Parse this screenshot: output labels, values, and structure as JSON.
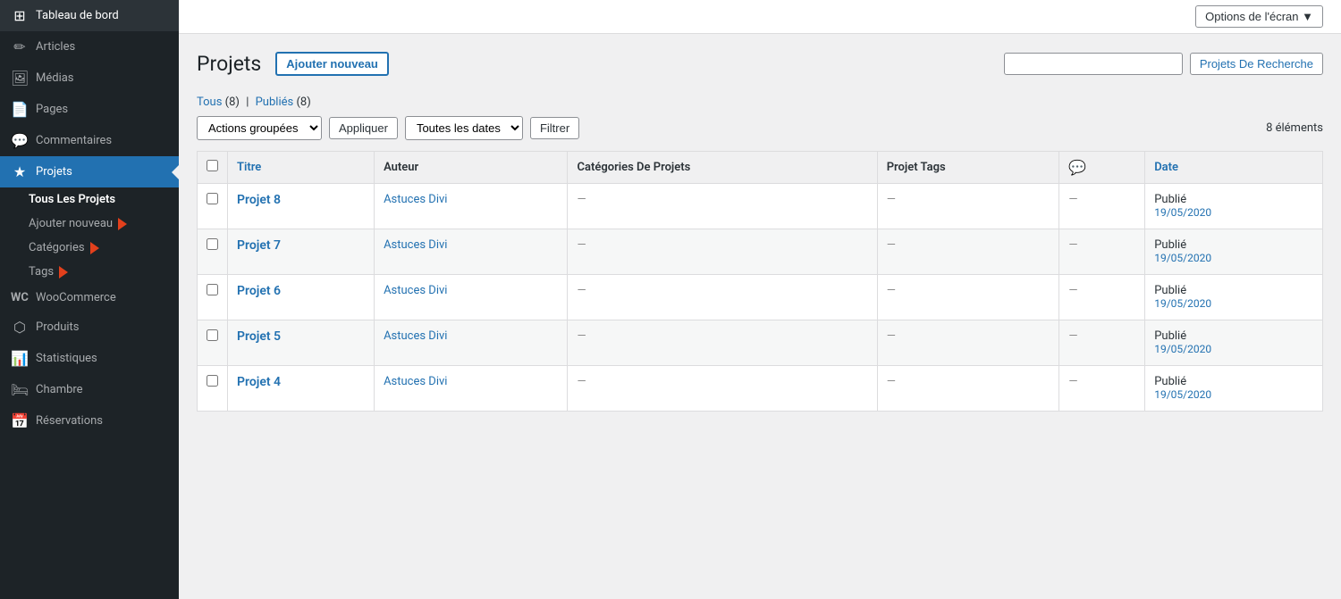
{
  "sidebar": {
    "items": [
      {
        "id": "tableau-de-bord",
        "label": "Tableau de bord",
        "icon": "⊞"
      },
      {
        "id": "articles",
        "label": "Articles",
        "icon": "✏"
      },
      {
        "id": "medias",
        "label": "Médias",
        "icon": "🖼"
      },
      {
        "id": "pages",
        "label": "Pages",
        "icon": "📄"
      },
      {
        "id": "commentaires",
        "label": "Commentaires",
        "icon": "💬"
      },
      {
        "id": "projets",
        "label": "Projets",
        "icon": "★",
        "active": true
      },
      {
        "id": "woocommerce",
        "label": "WooCommerce",
        "icon": "W"
      },
      {
        "id": "produits",
        "label": "Produits",
        "icon": "⬡"
      },
      {
        "id": "statistiques",
        "label": "Statistiques",
        "icon": "📊"
      },
      {
        "id": "chambre",
        "label": "Chambre",
        "icon": "🛏"
      },
      {
        "id": "reservations",
        "label": "Réservations",
        "icon": "📅"
      }
    ],
    "submenu": {
      "header": "Tous Les Projets",
      "items": [
        {
          "id": "ajouter-nouveau",
          "label": "Ajouter nouveau"
        },
        {
          "id": "categories",
          "label": "Catégories"
        },
        {
          "id": "tags",
          "label": "Tags"
        }
      ]
    }
  },
  "topbar": {
    "options_label": "Options de l'écran ▼"
  },
  "header": {
    "title": "Projets",
    "add_new_label": "Ajouter nouveau"
  },
  "filter_links": {
    "all_label": "Tous",
    "all_count": "(8)",
    "separator": "|",
    "published_label": "Publiés",
    "published_count": "(8)"
  },
  "search": {
    "placeholder": "",
    "button_label": "Projets De Recherche"
  },
  "filters": {
    "actions_label": "Actions groupées",
    "apply_label": "Appliquer",
    "dates_label": "Toutes les dates",
    "filter_label": "Filtrer",
    "items_count": "8 éléments"
  },
  "table": {
    "columns": [
      {
        "id": "titre",
        "label": "Titre",
        "sortable": true
      },
      {
        "id": "auteur",
        "label": "Auteur",
        "sortable": false
      },
      {
        "id": "categories",
        "label": "Catégories De Projets",
        "sortable": false
      },
      {
        "id": "tags",
        "label": "Projet Tags",
        "sortable": false
      },
      {
        "id": "comments",
        "label": "💬",
        "sortable": false
      },
      {
        "id": "date",
        "label": "Date",
        "sortable": true
      }
    ],
    "rows": [
      {
        "id": 1,
        "titre": "Projet 8",
        "auteur": "Astuces Divi",
        "categories": "—",
        "tags": "—",
        "comments": "—",
        "status": "Publié",
        "date": "19/05/2020"
      },
      {
        "id": 2,
        "titre": "Projet 7",
        "auteur": "Astuces Divi",
        "categories": "—",
        "tags": "—",
        "comments": "—",
        "status": "Publié",
        "date": "19/05/2020"
      },
      {
        "id": 3,
        "titre": "Projet 6",
        "auteur": "Astuces Divi",
        "categories": "—",
        "tags": "—",
        "comments": "—",
        "status": "Publié",
        "date": "19/05/2020"
      },
      {
        "id": 4,
        "titre": "Projet 5",
        "auteur": "Astuces Divi",
        "categories": "—",
        "tags": "—",
        "comments": "—",
        "status": "Publié",
        "date": "19/05/2020"
      },
      {
        "id": 5,
        "titre": "Projet 4",
        "auteur": "Astuces Divi",
        "categories": "—",
        "tags": "—",
        "comments": "—",
        "status": "Publié",
        "date": "19/05/2020"
      }
    ]
  }
}
